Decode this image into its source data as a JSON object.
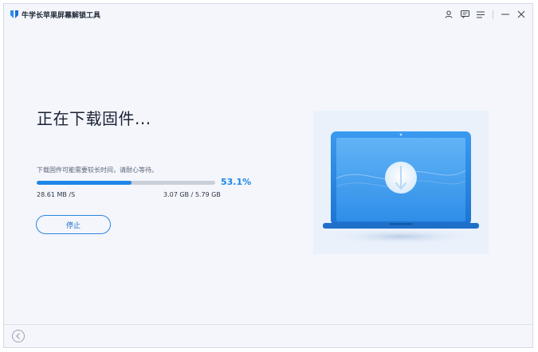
{
  "app": {
    "title": "牛学长苹果屏幕解锁工具",
    "logo_icon": "app-logo-icon"
  },
  "window_controls": {
    "icons": [
      "user-icon",
      "feedback-icon",
      "menu-icon",
      "minimize-icon",
      "close-icon"
    ]
  },
  "main": {
    "heading": "正在下载固件...",
    "hint": "下载固件可能需要较长时间，请耐心等待。",
    "progress": {
      "fraction": 0.531,
      "percent_label": "53.1%",
      "speed": "28.61 MB /S",
      "size": "3.07 GB / 5.79 GB"
    },
    "stop_label": "停止"
  },
  "illustration": {
    "icon": "laptop-icon"
  },
  "footer": {
    "back_icon": "back-arrow-icon"
  },
  "colors": {
    "accent": "#1e86e8",
    "background": "#f4f6fc",
    "track": "#c9ced8"
  }
}
